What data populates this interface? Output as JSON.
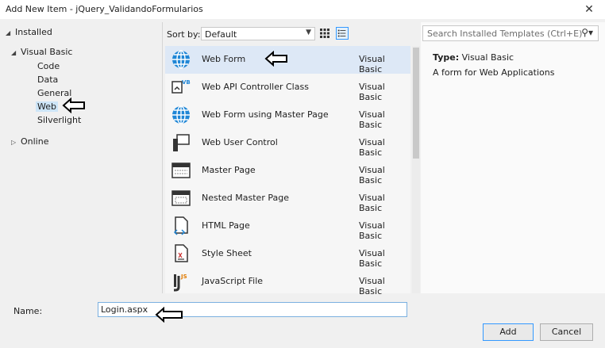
{
  "window": {
    "title": "Add New Item - jQuery_ValidandoFormularios",
    "close_glyph": "✕"
  },
  "tree": {
    "installed": "Installed",
    "visual_basic": "Visual Basic",
    "children": [
      "Code",
      "Data",
      "General",
      "Web",
      "Silverlight"
    ],
    "selected": "Web",
    "online": "Online"
  },
  "toolbar": {
    "sort_label": "Sort by:",
    "sort_value": "Default"
  },
  "templates": [
    {
      "name": "Web Form",
      "language": "Visual Basic",
      "icon": "globe-icon"
    },
    {
      "name": "Web API Controller Class",
      "language": "Visual Basic",
      "icon": "vb-class-icon"
    },
    {
      "name": "Web Form using Master Page",
      "language": "Visual Basic",
      "icon": "globe-icon"
    },
    {
      "name": "Web User Control",
      "language": "Visual Basic",
      "icon": "user-control-icon"
    },
    {
      "name": "Master Page",
      "language": "Visual Basic",
      "icon": "master-page-icon"
    },
    {
      "name": "Nested Master Page",
      "language": "Visual Basic",
      "icon": "master-page-icon"
    },
    {
      "name": "HTML Page",
      "language": "Visual Basic",
      "icon": "html-page-icon"
    },
    {
      "name": "Style Sheet",
      "language": "Visual Basic",
      "icon": "stylesheet-icon"
    },
    {
      "name": "JavaScript File",
      "language": "Visual Basic",
      "icon": "js-file-icon"
    }
  ],
  "details": {
    "search_placeholder": "Search Installed Templates (Ctrl+E)",
    "type_label": "Type:",
    "type_value": "Visual Basic",
    "description": "A form for Web Applications"
  },
  "footer": {
    "name_label": "Name:",
    "name_value": "Login.aspx",
    "add_label": "Add",
    "cancel_label": "Cancel"
  },
  "colors": {
    "accent": "#3399ff",
    "selection": "#dde8f6",
    "icon_blue": "#1f86d6"
  }
}
